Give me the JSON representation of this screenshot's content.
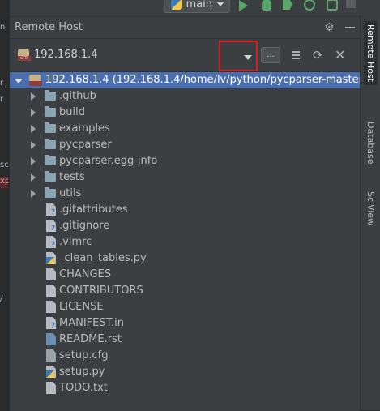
{
  "toolbar": {
    "branch": "main"
  },
  "panel": {
    "title": "Remote Host",
    "host": "192.168.1.4",
    "browse_label": "..."
  },
  "tree": {
    "root": "192.168.1.4 (192.168.1.4/home/lv/python/pycparser-master)",
    "folders": [
      ".github",
      "build",
      "examples",
      "pycparser",
      "pycparser.egg-info",
      "tests",
      "utils"
    ],
    "files": [
      {
        "name": ".gitattributes",
        "icon": "unknown-file-icon"
      },
      {
        "name": ".gitignore",
        "icon": "unknown-file-icon"
      },
      {
        "name": ".vimrc",
        "icon": "unknown-file-icon"
      },
      {
        "name": "_clean_tables.py",
        "icon": "python-file-icon"
      },
      {
        "name": "CHANGES",
        "icon": "text-file-icon"
      },
      {
        "name": "CONTRIBUTORS",
        "icon": "text-file-icon"
      },
      {
        "name": "LICENSE",
        "icon": "text-file-icon"
      },
      {
        "name": "MANIFEST.in",
        "icon": "unknown-file-icon"
      },
      {
        "name": "README.rst",
        "icon": "rst-file-icon"
      },
      {
        "name": "setup.cfg",
        "icon": "config-file-icon"
      },
      {
        "name": "setup.py",
        "icon": "python-file-icon"
      },
      {
        "name": "TODO.txt",
        "icon": "text-file-icon"
      }
    ]
  },
  "right_tabs": [
    "Remote Host",
    "Database",
    "SciView"
  ],
  "left_strip": [
    "n",
    "r",
    "r",
    "sc",
    "xp",
    "/"
  ],
  "colors": {
    "selection": "#4b6eaf",
    "highlight_box": "#e02020",
    "run_green": "#59a869"
  }
}
